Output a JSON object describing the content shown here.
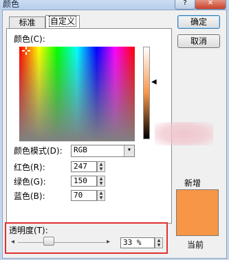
{
  "window": {
    "title": "颜色",
    "help_label": "?",
    "close_label": "✕"
  },
  "tabs": [
    {
      "label": "标准"
    },
    {
      "label": "自定义"
    }
  ],
  "buttons": {
    "ok": "确定",
    "cancel": "取消"
  },
  "picker": {
    "colors_label": "颜色(C):"
  },
  "model": {
    "label": "颜色模式(D):",
    "value": "RGB"
  },
  "red": {
    "label": "红色(R):",
    "value": "247"
  },
  "green": {
    "label": "绿色(G):",
    "value": "150"
  },
  "blue": {
    "label": "蓝色(B):",
    "value": "70"
  },
  "transparency": {
    "label": "透明度(T):",
    "value": "33 %",
    "level_percent": 33
  },
  "preview": {
    "new_label": "新增",
    "current_label": "当前",
    "new_color": "#f79646"
  },
  "icons": {
    "arrow_left": "◂",
    "arrow_right": "▸",
    "pointer": "◀",
    "dropdown": "▾"
  }
}
